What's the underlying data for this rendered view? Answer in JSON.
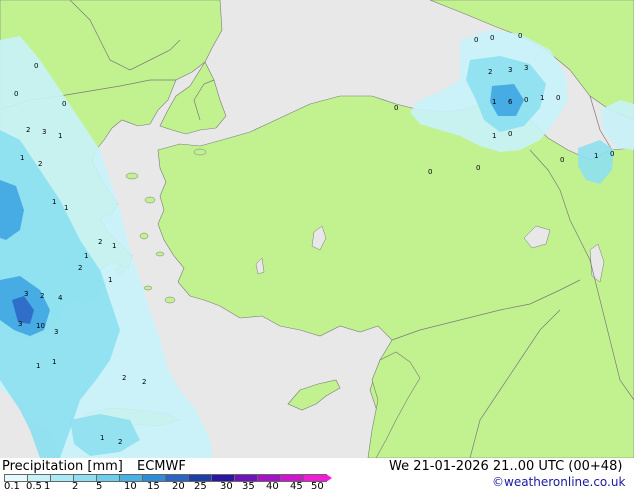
{
  "header": {
    "title": "Precipitation [mm]",
    "model": "ECMWF",
    "valid_time": "We 21-01-2026 21..00 UTC (00+48)",
    "credit": "©weatheronline.co.uk"
  },
  "colors": {
    "sea": "#e8e8e8",
    "land": "#c2f290",
    "border": "#7a7a7a",
    "precip_light": "#c8f2f8",
    "precip_mid": "#8ee0f0",
    "precip_heavy": "#3fa6e2",
    "precip_extreme": "#2c64c4"
  },
  "legend": {
    "labels": [
      "0.1",
      "0.5",
      "1",
      "2",
      "5",
      "10",
      "15",
      "20",
      "25",
      "30",
      "35",
      "40",
      "45",
      "50"
    ],
    "colors": [
      "#e6f9ff",
      "#c8f2f8",
      "#a8eaf5",
      "#8ee0f0",
      "#6ccfee",
      "#46b2e6",
      "#2f8cd6",
      "#2c64c4",
      "#1c3fa8",
      "#2a16a0",
      "#6e14b8",
      "#a414c4",
      "#d014d0",
      "#f01cd6"
    ]
  },
  "map_values": [
    {
      "v": "0",
      "c": "inland-w"
    },
    {
      "v": "0",
      "c": "greece-n"
    },
    {
      "v": "0",
      "c": "greece-n"
    },
    {
      "v": "2",
      "c": "greece"
    },
    {
      "v": "3",
      "c": "greece"
    },
    {
      "v": "1",
      "c": "greece"
    },
    {
      "v": "2",
      "c": "greece"
    },
    {
      "v": "1",
      "c": "greece"
    },
    {
      "v": "1",
      "c": "greece"
    },
    {
      "v": "1",
      "c": "greece"
    },
    {
      "v": "2",
      "c": "aegean"
    },
    {
      "v": "1",
      "c": "aegean"
    },
    {
      "v": "1",
      "c": "aegean"
    },
    {
      "v": "2",
      "c": "aegean"
    },
    {
      "v": "1",
      "c": "aegean"
    },
    {
      "v": "3",
      "c": "peloponnese"
    },
    {
      "v": "2",
      "c": "peloponnese"
    },
    {
      "v": "4",
      "c": "peloponnese"
    },
    {
      "v": "3",
      "c": "peloponnese"
    },
    {
      "v": "10",
      "c": "peloponnese"
    },
    {
      "v": "3",
      "c": "peloponnese"
    },
    {
      "v": "1",
      "c": "crete"
    },
    {
      "v": "1",
      "c": "crete"
    },
    {
      "v": "2",
      "c": "crete"
    },
    {
      "v": "2",
      "c": "crete"
    },
    {
      "v": "1",
      "c": "crete"
    },
    {
      "v": "2",
      "c": "crete"
    },
    {
      "v": "0",
      "c": "blacksea-e"
    },
    {
      "v": "0",
      "c": "blacksea-e"
    },
    {
      "v": "0",
      "c": "blacksea-e"
    },
    {
      "v": "2",
      "c": "blacksea-e"
    },
    {
      "v": "3",
      "c": "blacksea-e"
    },
    {
      "v": "3",
      "c": "blacksea-e"
    },
    {
      "v": "1",
      "c": "blacksea-e"
    },
    {
      "v": "6",
      "c": "blacksea-e"
    },
    {
      "v": "0",
      "c": "blacksea-e"
    },
    {
      "v": "1",
      "c": "blacksea-e"
    },
    {
      "v": "0",
      "c": "blacksea-e"
    },
    {
      "v": "1",
      "c": "blacksea-e"
    },
    {
      "v": "0",
      "c": "blacksea-e"
    },
    {
      "v": "0",
      "c": "anatolia"
    },
    {
      "v": "0",
      "c": "anatolia"
    },
    {
      "v": "0",
      "c": "anatolia"
    },
    {
      "v": "0",
      "c": "caucasus"
    },
    {
      "v": "1",
      "c": "caucasus"
    },
    {
      "v": "0",
      "c": "caucasus"
    }
  ]
}
